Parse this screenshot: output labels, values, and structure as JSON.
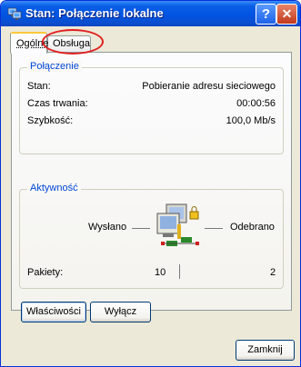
{
  "window": {
    "title": "Stan: Połączenie lokalne"
  },
  "titlebar_buttons": {
    "help": "?",
    "close": "✕"
  },
  "tabs": [
    {
      "label": "Ogólne",
      "active": true
    },
    {
      "label": "Obsługa",
      "active": false,
      "highlighted": true
    }
  ],
  "connection": {
    "title": "Połączenie",
    "rows": [
      {
        "label": "Stan:",
        "value": "Pobieranie adresu sieciowego"
      },
      {
        "label": "Czas trwania:",
        "value": "00:00:56"
      },
      {
        "label": "Szybkość:",
        "value": "100,0 Mb/s"
      }
    ]
  },
  "activity": {
    "title": "Aktywność",
    "sent_label": "Wysłano",
    "received_label": "Odebrano",
    "packets_label": "Pakiety:",
    "packets_sent": "10",
    "packets_received": "2"
  },
  "buttons": {
    "properties": "Właściwości",
    "disable": "Wyłącz",
    "close": "Zamknij"
  },
  "colors": {
    "titlebar": "#0054e3",
    "group_title": "#0046d5",
    "highlight": "#e02020",
    "tab_accent": "#ffc83c"
  },
  "icons": {
    "title": "network-connection-icon",
    "activity": "network-computers-icon"
  }
}
